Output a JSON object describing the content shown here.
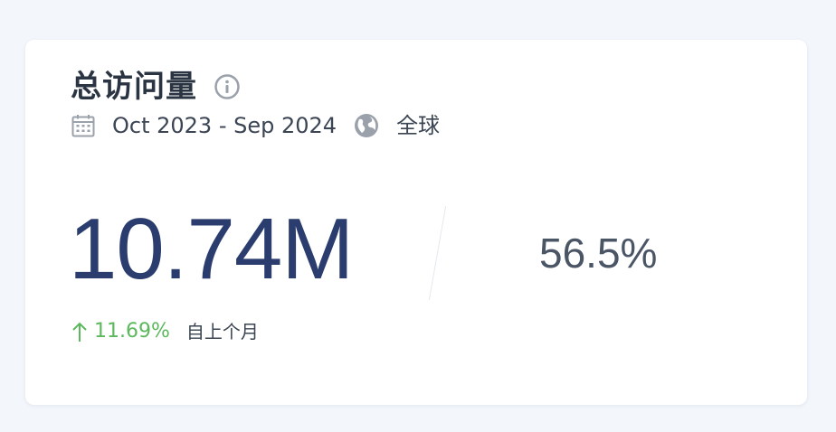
{
  "card": {
    "title": "总访问量",
    "date_range": "Oct 2023 - Sep 2024",
    "region": "全球",
    "total_visits": "10.74M",
    "share": "56.5%",
    "change_value": "11.69%",
    "change_label": "自上个月"
  },
  "icons": {
    "info": "info-icon",
    "calendar": "calendar-icon",
    "globe": "globe-icon",
    "arrow": "arrow-up-icon"
  },
  "colors": {
    "title": "#2b3442",
    "value": "#2b3d6e",
    "positive": "#5cb85c",
    "icon": "#9aa1ab",
    "background": "#f3f6fb",
    "card": "#ffffff"
  }
}
